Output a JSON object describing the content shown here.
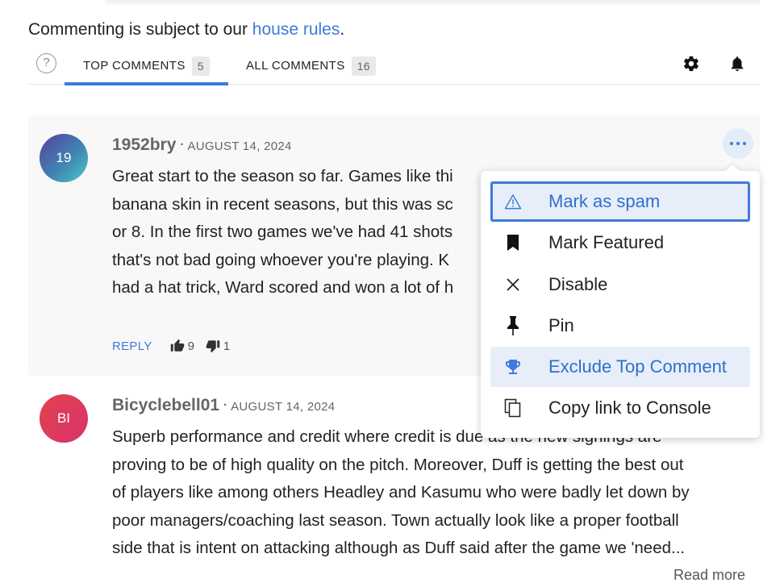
{
  "header": {
    "house_prefix": "Commenting is subject to our ",
    "house_link": "house rules",
    "house_suffix": "."
  },
  "tabs": [
    {
      "label": "TOP COMMENTS",
      "count": "5",
      "active": true
    },
    {
      "label": "ALL COMMENTS",
      "count": "16",
      "active": false
    }
  ],
  "help_icon": "?",
  "toolbar_icons": [
    "gear-icon",
    "bell-icon"
  ],
  "comments": [
    {
      "avatar": "19",
      "author": "1952bry",
      "date": "AUGUST 14, 2024",
      "text": "Great start to the season so far. Games like thi\nbanana skin in recent seasons, but this was sc\nor 8. In the first two games we've had 41 shots\nthat's not bad going whoever you're playing. K\nhad a hat trick, Ward scored and won a lot of h",
      "reply": "REPLY",
      "upvotes": "9",
      "downvotes": "1"
    },
    {
      "avatar": "BI",
      "author": "Bicyclebell01",
      "date": "AUGUST 14, 2024",
      "text": "Superb performance and credit where credit is due as the new signings are\nproving to be of high quality on the pitch. Moreover, Duff is getting the best out\nof players like among others Headley and Kasumu who were badly let down by\npoor managers/coaching last season. Town actually look like a proper football\nside that is intent on attacking although as Duff said after the game we 'need...",
      "read_more": "Read more"
    }
  ],
  "menu": {
    "items": [
      {
        "label": "Mark as spam",
        "icon": "warning-icon",
        "state": "focused"
      },
      {
        "label": "Mark Featured",
        "icon": "bookmark-icon",
        "state": "normal"
      },
      {
        "label": "Disable",
        "icon": "close-icon",
        "state": "normal"
      },
      {
        "label": "Pin",
        "icon": "pin-icon",
        "state": "normal"
      },
      {
        "label": "Exclude Top Comment",
        "icon": "trophy-icon",
        "state": "highlighted"
      },
      {
        "label": "Copy link to Console",
        "icon": "copy-icon",
        "state": "normal"
      }
    ]
  },
  "colors": {
    "accent": "#3d7bd9",
    "menu_highlight_bg": "#e8eef9",
    "comment_bg": "#f8f8f8"
  }
}
